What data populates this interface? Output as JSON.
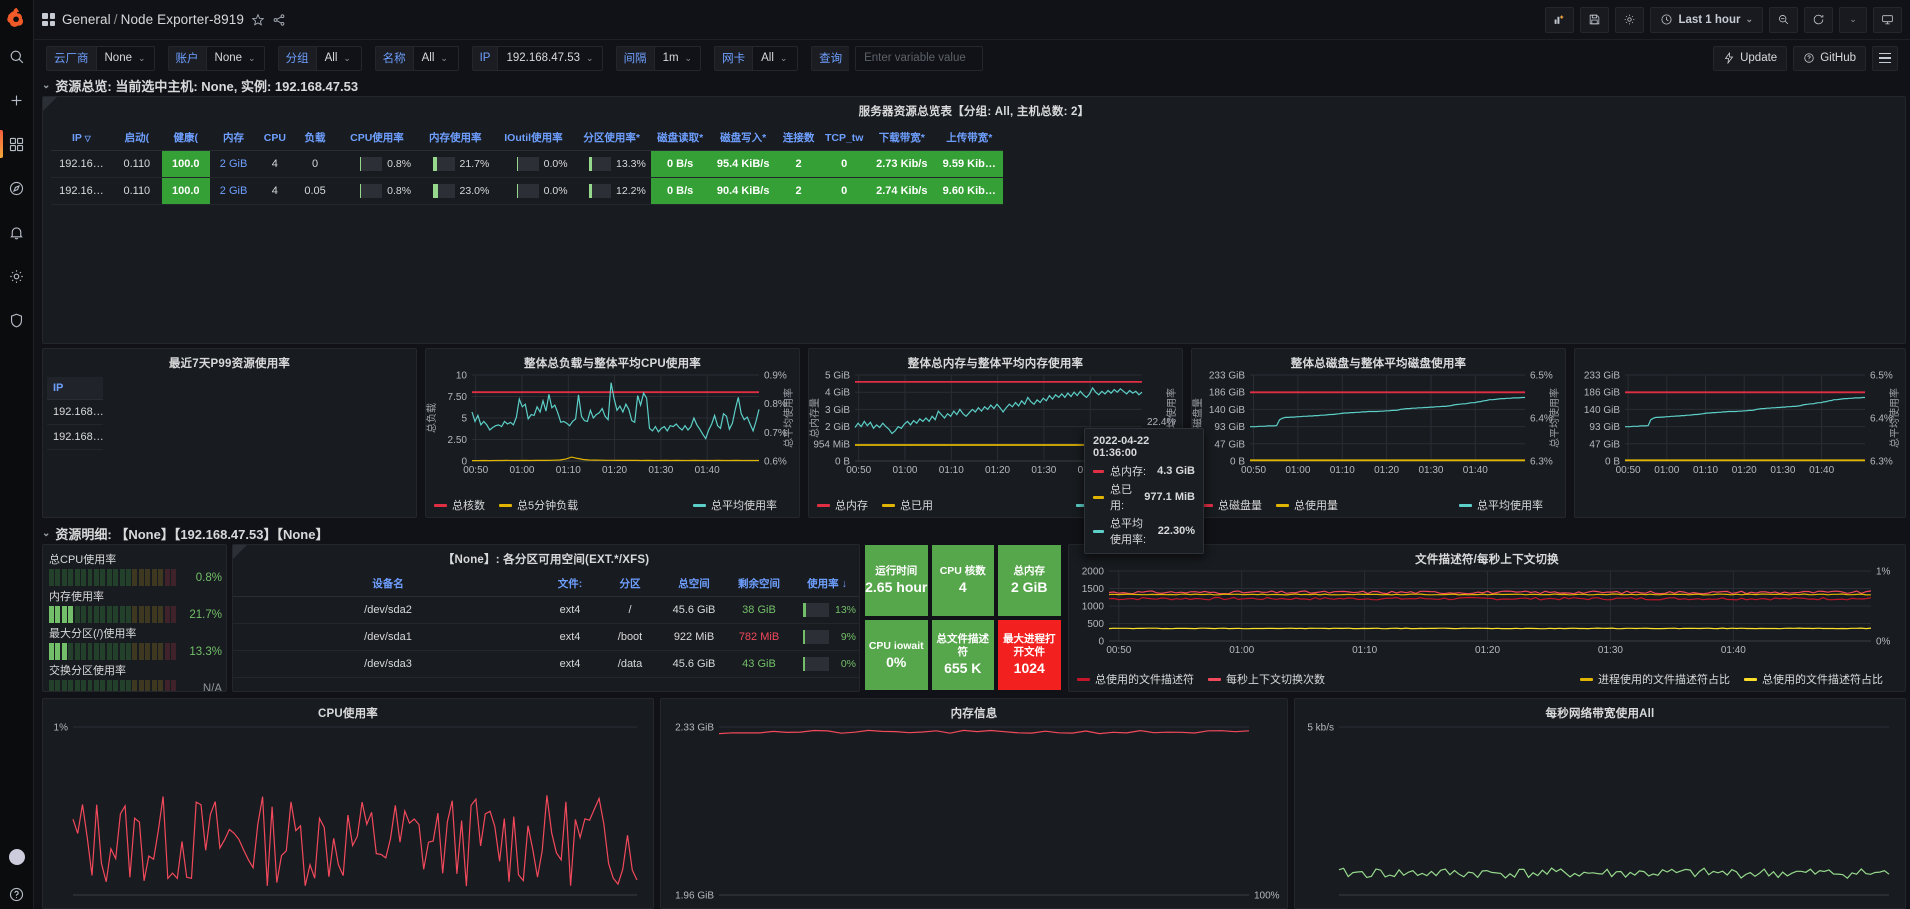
{
  "nav": {
    "logo": "grafana-logo",
    "items": [
      {
        "name": "search-icon",
        "label": "Search"
      },
      {
        "name": "plus-icon",
        "label": "Create"
      },
      {
        "name": "dashboards-icon",
        "label": "Dashboards"
      },
      {
        "name": "explore-icon",
        "label": "Explore"
      },
      {
        "name": "alerting-bell-icon",
        "label": "Alerting"
      },
      {
        "name": "gear-icon",
        "label": "Configuration"
      },
      {
        "name": "shield-icon",
        "label": "Server Admin"
      }
    ],
    "help_label": "?"
  },
  "topbar": {
    "folder": "General",
    "separator": "/",
    "dashboard": "Node Exporter-8919",
    "star_icon": "star-icon",
    "share_icon": "share-icon",
    "buttons": [
      {
        "name": "add-panel-button",
        "icon": "add-panel-icon"
      },
      {
        "name": "save-dashboard-button",
        "icon": "save-icon"
      },
      {
        "name": "dashboard-settings-button",
        "icon": "gear-icon"
      }
    ],
    "time_range": "Last 1 hour",
    "time_icon": "clock-icon",
    "zoom_out_icon": "zoom-out-icon",
    "refresh_icon": "refresh-icon",
    "tv_icon": "tv-icon"
  },
  "variables": [
    {
      "label": "云厂商",
      "value": "None"
    },
    {
      "label": "账户",
      "value": "None"
    },
    {
      "label": "分组",
      "value": "All"
    },
    {
      "label": "名称",
      "value": "All"
    },
    {
      "label": "IP",
      "value": "192.168.47.53"
    },
    {
      "label": "间隔",
      "value": "1m"
    },
    {
      "label": "网卡",
      "value": "All"
    },
    {
      "label": "查询",
      "value": "",
      "placeholder": "Enter variable value"
    }
  ],
  "varbar_right": {
    "update_label": "Update",
    "update_icon": "flash-icon",
    "github_label": "GitHub",
    "github_icon": "question-circle-icon",
    "menu_icon": "hamburger-icon"
  },
  "row_overview": {
    "title": "资源总览: 当前选中主机: None, 实例: 192.168.47.53"
  },
  "overview_table": {
    "panel_title": "服务器资源总览表【分组: All, 主机总数: 2】",
    "columns": [
      "IP",
      "启动(",
      "健康(",
      "内存",
      "CPU",
      "负载",
      "CPU使用率",
      "内存使用率",
      "IOutil使用率",
      "分区使用率*",
      "磁盘读取*",
      "磁盘写入*",
      "连接数",
      "TCP_tw",
      "下载带宽*",
      "上传带宽*"
    ],
    "rows": [
      {
        "ip": "192.16…",
        "uptime": "0.110",
        "health": "100.0",
        "mem": "2 GiB",
        "cpu": "4",
        "load": "0",
        "cpu_pct": "0.8%",
        "cpu_pct_v": 0.8,
        "mem_pct": "21.7%",
        "mem_pct_v": 21.7,
        "io_pct": "0.0%",
        "io_pct_v": 0.0,
        "part_pct": "13.3%",
        "part_pct_v": 13.3,
        "disk_read": "0 B/s",
        "disk_write": "95.4 KiB/s",
        "conn": "2",
        "tcp_tw": "0",
        "down": "2.73 Kib/s",
        "up": "9.59 Kib…"
      },
      {
        "ip": "192.16…",
        "uptime": "0.110",
        "health": "100.0",
        "mem": "2 GiB",
        "cpu": "4",
        "load": "0.05",
        "cpu_pct": "0.8%",
        "cpu_pct_v": 0.8,
        "mem_pct": "23.0%",
        "mem_pct_v": 23.0,
        "io_pct": "0.0%",
        "io_pct_v": 0.0,
        "part_pct": "12.2%",
        "part_pct_v": 12.2,
        "disk_read": "0 B/s",
        "disk_write": "90.4 KiB/s",
        "conn": "2",
        "tcp_tw": "0",
        "down": "2.74 Kib/s",
        "up": "9.60 Kib…"
      }
    ]
  },
  "p99_panel": {
    "title": "最近7天P99资源使用率",
    "column": "IP",
    "rows": [
      "192.168…",
      "192.168…"
    ]
  },
  "chart_data": [
    {
      "id": "load_cpu",
      "type": "line",
      "title": "整体总负载与整体平均CPU使用率",
      "xlabel": "",
      "ylabel": "总负载",
      "y2label": "总平均使用率",
      "xticks": [
        "00:50",
        "01:00",
        "01:10",
        "01:20",
        "01:30",
        "01:40"
      ],
      "yticks": [
        "0",
        "2.50",
        "5",
        "7.50",
        "10"
      ],
      "ylim": [
        0,
        10
      ],
      "y2ticks": [
        "0.6%",
        "0.7%",
        "0.8%",
        "0.9%"
      ],
      "y2lim": [
        0.6,
        0.9
      ],
      "grid": true,
      "legend_position": "bottom",
      "series": [
        {
          "name": "总核数",
          "color": "#e02f44",
          "constant": 8
        },
        {
          "name": "总5分钟负载",
          "color": "#e0b400",
          "values": [
            0.05,
            0.05,
            0.06,
            0.05,
            0.06,
            0.06,
            0.07,
            0.06,
            0.06,
            0.07,
            0.06,
            0.07,
            0.08,
            0.07,
            0.09,
            0.12,
            0.22,
            0.45,
            0.3,
            0.18,
            0.12,
            0.1,
            0.09,
            0.08,
            0.08,
            0.07,
            0.07,
            0.07,
            0.07,
            0.06,
            0.07,
            0.06,
            0.06,
            0.07,
            0.06,
            0.07,
            0.06,
            0.06,
            0.07,
            0.06,
            0.06,
            0.06,
            0.07,
            0.06,
            0.06,
            0.07,
            0.06,
            0.06,
            0.06,
            0.06
          ]
        },
        {
          "name": "总平均使用率",
          "color": "#5ccfc8",
          "values": [
            5.7,
            4.6,
            5.3,
            4.2,
            4.6,
            4.2,
            3.6,
            3.9,
            4.1,
            4.2,
            4.0,
            4.6,
            4.3,
            4.5,
            4.2,
            5.1,
            7.2,
            6.3,
            6.6,
            4.9,
            5.4,
            5.3,
            6.3,
            5.7,
            7.0,
            5.8,
            7.75,
            6.2,
            6.5,
            5.6,
            4.5,
            4.6,
            4.4,
            4.1,
            4.6,
            4.9,
            7.7,
            5.2,
            4.7,
            4.6,
            5.9,
            5.0,
            5.4,
            5.6,
            6.1,
            5.2,
            4.8,
            9.1,
            7.3,
            5.9,
            6.4,
            5.7,
            6.6,
            6.0,
            4.7,
            4.5,
            7.6,
            6.5,
            7.9,
            7.3,
            3.8,
            3.5,
            4.0,
            3.4,
            3.8,
            4.0,
            3.5,
            4.1,
            4.0,
            4.3,
            3.9,
            3.6,
            4.1,
            3.6,
            4.0,
            5.0,
            4.2,
            3.7,
            3.1,
            2.6,
            3.6,
            4.3,
            5.3,
            4.1,
            3.8,
            5.5,
            5.2,
            3.7,
            4.4,
            6.0,
            7.4,
            5.5,
            4.8,
            5.1,
            4.3,
            3.5,
            4.6,
            6.0
          ]
        }
      ]
    },
    {
      "id": "memory",
      "type": "line",
      "title": "整体总内存与整体平均内存使用率",
      "ylabel": "总内存量",
      "y2label": "总平均使用率",
      "xticks": [
        "00:50",
        "01:00",
        "01:10",
        "01:20",
        "01:30",
        "01:40"
      ],
      "yticks": [
        "0 B",
        "954 MiB",
        "2 GiB",
        "3 GiB",
        "4 GiB",
        "5 GiB"
      ],
      "y2ticks": [
        "22.3%",
        "22.4%"
      ],
      "grid": true,
      "legend_position": "bottom",
      "series": [
        {
          "name": "总内存",
          "color": "#e02f44",
          "constant": 4.6
        },
        {
          "name": "总已用",
          "color": "#e0b400",
          "constant": 0.93
        },
        {
          "name": "总平均使用率",
          "color": "#5ccfc8",
          "values": [
            1.95,
            2.2,
            2.0,
            2.3,
            2.05,
            2.25,
            1.9,
            2.1,
            1.95,
            2.2,
            2.0,
            1.85,
            1.6,
            1.75,
            2.0,
            1.9,
            2.15,
            2.3,
            2.1,
            2.35,
            2.2,
            2.45,
            2.3,
            2.5,
            2.3,
            2.6,
            2.4,
            2.9,
            2.7,
            2.5,
            2.75,
            2.6,
            2.9,
            2.7,
            3.0,
            2.75,
            2.6,
            2.8,
            3.0,
            2.85,
            3.1,
            2.9,
            3.15,
            3.0,
            3.25,
            3.05,
            3.3,
            3.1,
            2.85,
            3.1,
            3.3,
            3.15,
            3.4,
            3.2,
            3.5,
            3.3,
            3.7,
            3.45,
            3.3,
            3.55,
            3.4,
            3.65,
            3.5,
            3.8,
            3.6,
            3.85,
            3.7,
            3.9,
            3.7,
            3.95,
            3.75,
            4.0,
            3.8,
            4.05,
            3.85,
            3.7,
            3.9,
            4.25,
            4.0,
            3.85,
            4.05,
            3.9,
            4.1,
            3.95,
            4.15,
            4.0,
            4.2,
            4.05,
            3.9,
            4.1,
            3.95,
            4.05,
            3.85,
            4.0
          ]
        }
      ],
      "tooltip": {
        "time": "2022-04-22 01:36:00",
        "rows": [
          {
            "name": "总内存:",
            "value": "4.3 GiB",
            "color": "#e02f44"
          },
          {
            "name": "总已用:",
            "value": "977.1 MiB",
            "color": "#e0b400"
          },
          {
            "name": "总平均使用率:",
            "value": "22.30%",
            "color": "#5ccfc8"
          }
        ]
      }
    },
    {
      "id": "disk",
      "type": "line",
      "title": "整体总磁盘与整体平均磁盘使用率",
      "ylabel": "总磁盘量",
      "y2label": "总平均使用率",
      "xticks": [
        "00:50",
        "01:00",
        "01:10",
        "01:20",
        "01:30",
        "01:40"
      ],
      "yticks": [
        "0 B",
        "47 GiB",
        "93 GiB",
        "140 GiB",
        "186 GiB",
        "233 GiB"
      ],
      "y2ticks": [
        "6.3%",
        "6.4%",
        "6.5%"
      ],
      "grid": true,
      "legend_position": "bottom",
      "series": [
        {
          "name": "总磁盘量",
          "color": "#e02f44",
          "constant": 186
        },
        {
          "name": "总使用量",
          "color": "#e0b400",
          "constant": 2
        },
        {
          "name": "总平均使用率",
          "color": "#5ccfc8",
          "values": [
            93,
            93,
            93,
            94,
            94,
            94,
            95,
            95,
            95,
            96,
            112,
            116,
            118,
            118,
            119,
            119,
            120,
            120,
            121,
            121,
            122,
            122,
            123,
            123,
            124,
            124,
            125,
            126,
            126,
            127,
            128,
            129,
            130,
            130,
            131,
            131,
            132,
            132,
            133,
            133,
            134,
            134,
            134,
            134,
            135,
            135,
            136,
            136,
            137,
            137,
            138,
            140,
            141,
            142,
            142,
            143,
            143,
            144,
            144,
            145,
            145,
            146,
            146,
            147,
            147,
            148,
            148,
            149,
            150,
            152,
            153,
            154,
            155,
            155,
            157,
            158,
            158,
            160,
            161,
            163,
            164,
            166,
            166,
            167,
            168,
            169,
            169,
            170,
            170,
            171,
            171,
            171,
            172,
            172
          ]
        }
      ]
    },
    {
      "id": "fd_ctx",
      "type": "line",
      "title": "文件描述符/每秒上下文切换",
      "xticks": [
        "00:50",
        "01:00",
        "01:10",
        "01:20",
        "01:30",
        "01:40"
      ],
      "yticks": [
        "0",
        "500",
        "1000",
        "1500",
        "2000"
      ],
      "ylim": [
        0,
        2000
      ],
      "y2ticks": [
        "0%",
        "1%"
      ],
      "grid": true,
      "legend_position": "bottom",
      "series": [
        {
          "name": "总使用的文件描述符",
          "color": "#c4162a"
        },
        {
          "name": "每秒上下文切换次数",
          "color": "#f2495c"
        },
        {
          "name": "进程使用的文件描述符占比",
          "color": "#e0b400"
        },
        {
          "name": "总使用的文件描述符占比",
          "color": "#fade2a"
        }
      ]
    },
    {
      "id": "cpu_usage_bottom",
      "type": "line",
      "title": "CPU使用率",
      "yticks": [
        "1%"
      ]
    },
    {
      "id": "mem_info_bottom",
      "type": "line",
      "title": "内存信息",
      "yticks": [
        "2.33 GiB",
        "1.96 GiB"
      ],
      "y2ticks": [
        "100%"
      ]
    },
    {
      "id": "net_bw_bottom",
      "type": "line",
      "title": "每秒网络带宽使用All",
      "yticks": [
        "5 kb/s"
      ]
    }
  ],
  "row_detail": {
    "title": "资源明细: 【None】【192.168.47.53】【None】"
  },
  "bargauges": [
    {
      "label": "总CPU使用率",
      "value": "0.8%",
      "pct": 0.8,
      "color": "#73bf69"
    },
    {
      "label": "内存使用率",
      "value": "21.7%",
      "pct": 21.7,
      "color": "#73bf69"
    },
    {
      "label": "最大分区(/)使用率",
      "value": "13.3%",
      "pct": 13.3,
      "color": "#73bf69"
    },
    {
      "label": "交换分区使用率",
      "value": "N/A",
      "pct": 0,
      "color": "#73bf69"
    }
  ],
  "partition_table": {
    "panel_title": "【None】: 各分区可用空间(EXT.*/XFS)",
    "columns": [
      "设备名",
      "文件:",
      "分区",
      "总空间",
      "剩余空间",
      "使用率 ↓"
    ],
    "rows": [
      {
        "device": "/dev/sda2",
        "fs": "ext4",
        "mount": "/",
        "total": "45.6 GiB",
        "free": "38 GiB",
        "free_color": "#73bf69",
        "usage": "13%",
        "usage_v": 13
      },
      {
        "device": "/dev/sda1",
        "fs": "ext4",
        "mount": "/boot",
        "total": "922 MiB",
        "free": "782 MiB",
        "free_color": "#f2495c",
        "usage": "9%",
        "usage_v": 9
      },
      {
        "device": "/dev/sda3",
        "fs": "ext4",
        "mount": "/data",
        "total": "45.6 GiB",
        "free": "43 GiB",
        "free_color": "#73bf69",
        "usage": "0%",
        "usage_v": 1
      }
    ]
  },
  "tiles": [
    {
      "name": "运行时间",
      "value": "2.65 hour",
      "color": "#56a64b"
    },
    {
      "name": "CPU 核数",
      "value": "4",
      "color": "#56a64b"
    },
    {
      "name": "总内存",
      "value": "2 GiB",
      "color": "#56a64b"
    },
    {
      "name": "CPU iowait",
      "value": "0%",
      "color": "#56a64b"
    },
    {
      "name": "总文件描述符",
      "value": "655 K",
      "color": "#56a64b"
    },
    {
      "name": "最大进程打开文件",
      "value": "1024",
      "color": "#f2201f"
    }
  ]
}
